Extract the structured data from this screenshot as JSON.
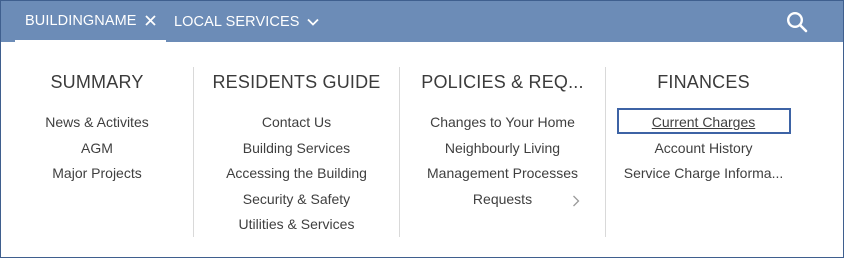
{
  "topbar": {
    "tab_building": "BUILDINGNAME",
    "tab_local": "LOCAL SERVICES",
    "background": "#6c8cb7"
  },
  "columns": {
    "summary": {
      "title": "SUMMARY",
      "items": [
        "News & Activites",
        "AGM",
        "Major Projects"
      ]
    },
    "residents": {
      "title": "RESIDENTS GUIDE",
      "items": [
        "Contact Us",
        "Building Services",
        "Accessing the Building",
        "Security & Safety",
        "Utilities & Services"
      ]
    },
    "policies": {
      "title": "POLICIES & REQ...",
      "items": [
        "Changes to Your Home",
        "Neighbourly Living",
        "Management Processes",
        "Requests"
      ]
    },
    "finances": {
      "title": "FINANCES",
      "items": [
        "Current Charges",
        "Account History",
        "Service Charge Informa..."
      ]
    }
  },
  "colors": {
    "focus_outline": "#3d63a5",
    "text": "#3f3f3f"
  }
}
